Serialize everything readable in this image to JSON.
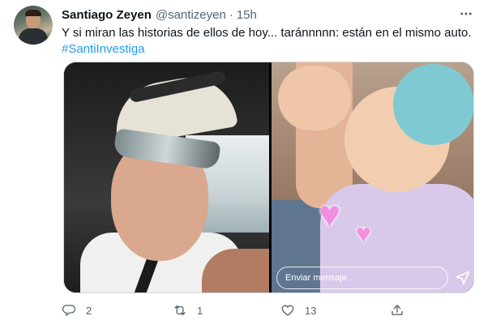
{
  "tweet": {
    "author": {
      "name": "Santiago Zeyen",
      "handle": "@santizeyen",
      "separator": "·",
      "time": "15h"
    },
    "text": "Y si miran las historias de ellos de hoy... taránnnnn: están en el mismo auto.",
    "hashtag": "#SantiInvestiga",
    "media": {
      "story_reply_placeholder": "Enviar mensaje"
    },
    "actions": {
      "reply_count": "2",
      "retweet_count": "1",
      "like_count": "13"
    }
  },
  "colors": {
    "text": "#0f1419",
    "secondary": "#536471",
    "link": "#1d9bf0",
    "heart_sticker": "#f28fe0"
  },
  "icons": {
    "more": "more-icon",
    "reply": "reply-icon",
    "retweet": "retweet-icon",
    "like": "like-icon",
    "share": "share-icon",
    "send": "send-icon",
    "sticker": "heart-icon"
  }
}
